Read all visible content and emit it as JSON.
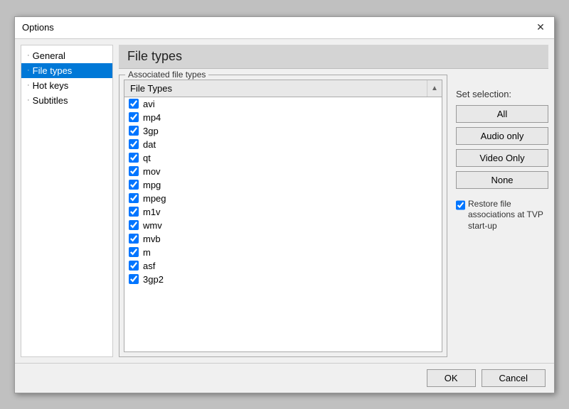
{
  "dialog": {
    "title": "Options",
    "close_icon": "✕"
  },
  "sidebar": {
    "items": [
      {
        "id": "general",
        "label": "General",
        "selected": false,
        "dash": "·"
      },
      {
        "id": "file-types",
        "label": "File types",
        "selected": true,
        "dash": "·"
      },
      {
        "id": "hot-keys",
        "label": "Hot keys",
        "selected": false,
        "dash": "·"
      },
      {
        "id": "subtitles",
        "label": "Subtitles",
        "selected": false,
        "dash": "·"
      }
    ]
  },
  "main": {
    "header": "File types",
    "section_label": "Associated file types",
    "column_header": "File Types",
    "file_list": [
      {
        "name": "avi",
        "checked": true
      },
      {
        "name": "mp4",
        "checked": true
      },
      {
        "name": "3gp",
        "checked": true
      },
      {
        "name": "dat",
        "checked": true
      },
      {
        "name": "qt",
        "checked": true
      },
      {
        "name": "mov",
        "checked": true
      },
      {
        "name": "mpg",
        "checked": true
      },
      {
        "name": "mpeg",
        "checked": true
      },
      {
        "name": "m1v",
        "checked": true
      },
      {
        "name": "wmv",
        "checked": true
      },
      {
        "name": "mvb",
        "checked": true
      },
      {
        "name": "m",
        "checked": true
      },
      {
        "name": "asf",
        "checked": true
      },
      {
        "name": "3gp2",
        "checked": true
      }
    ],
    "right_panel": {
      "set_selection_label": "Set selection:",
      "buttons": [
        {
          "id": "all",
          "label": "All"
        },
        {
          "id": "audio-only",
          "label": "Audio only"
        },
        {
          "id": "video-only",
          "label": "Video Only"
        },
        {
          "id": "none",
          "label": "None"
        }
      ],
      "restore_checked": true,
      "restore_label": "Restore file associations at TVP start-up"
    }
  },
  "footer": {
    "ok_label": "OK",
    "cancel_label": "Cancel"
  }
}
